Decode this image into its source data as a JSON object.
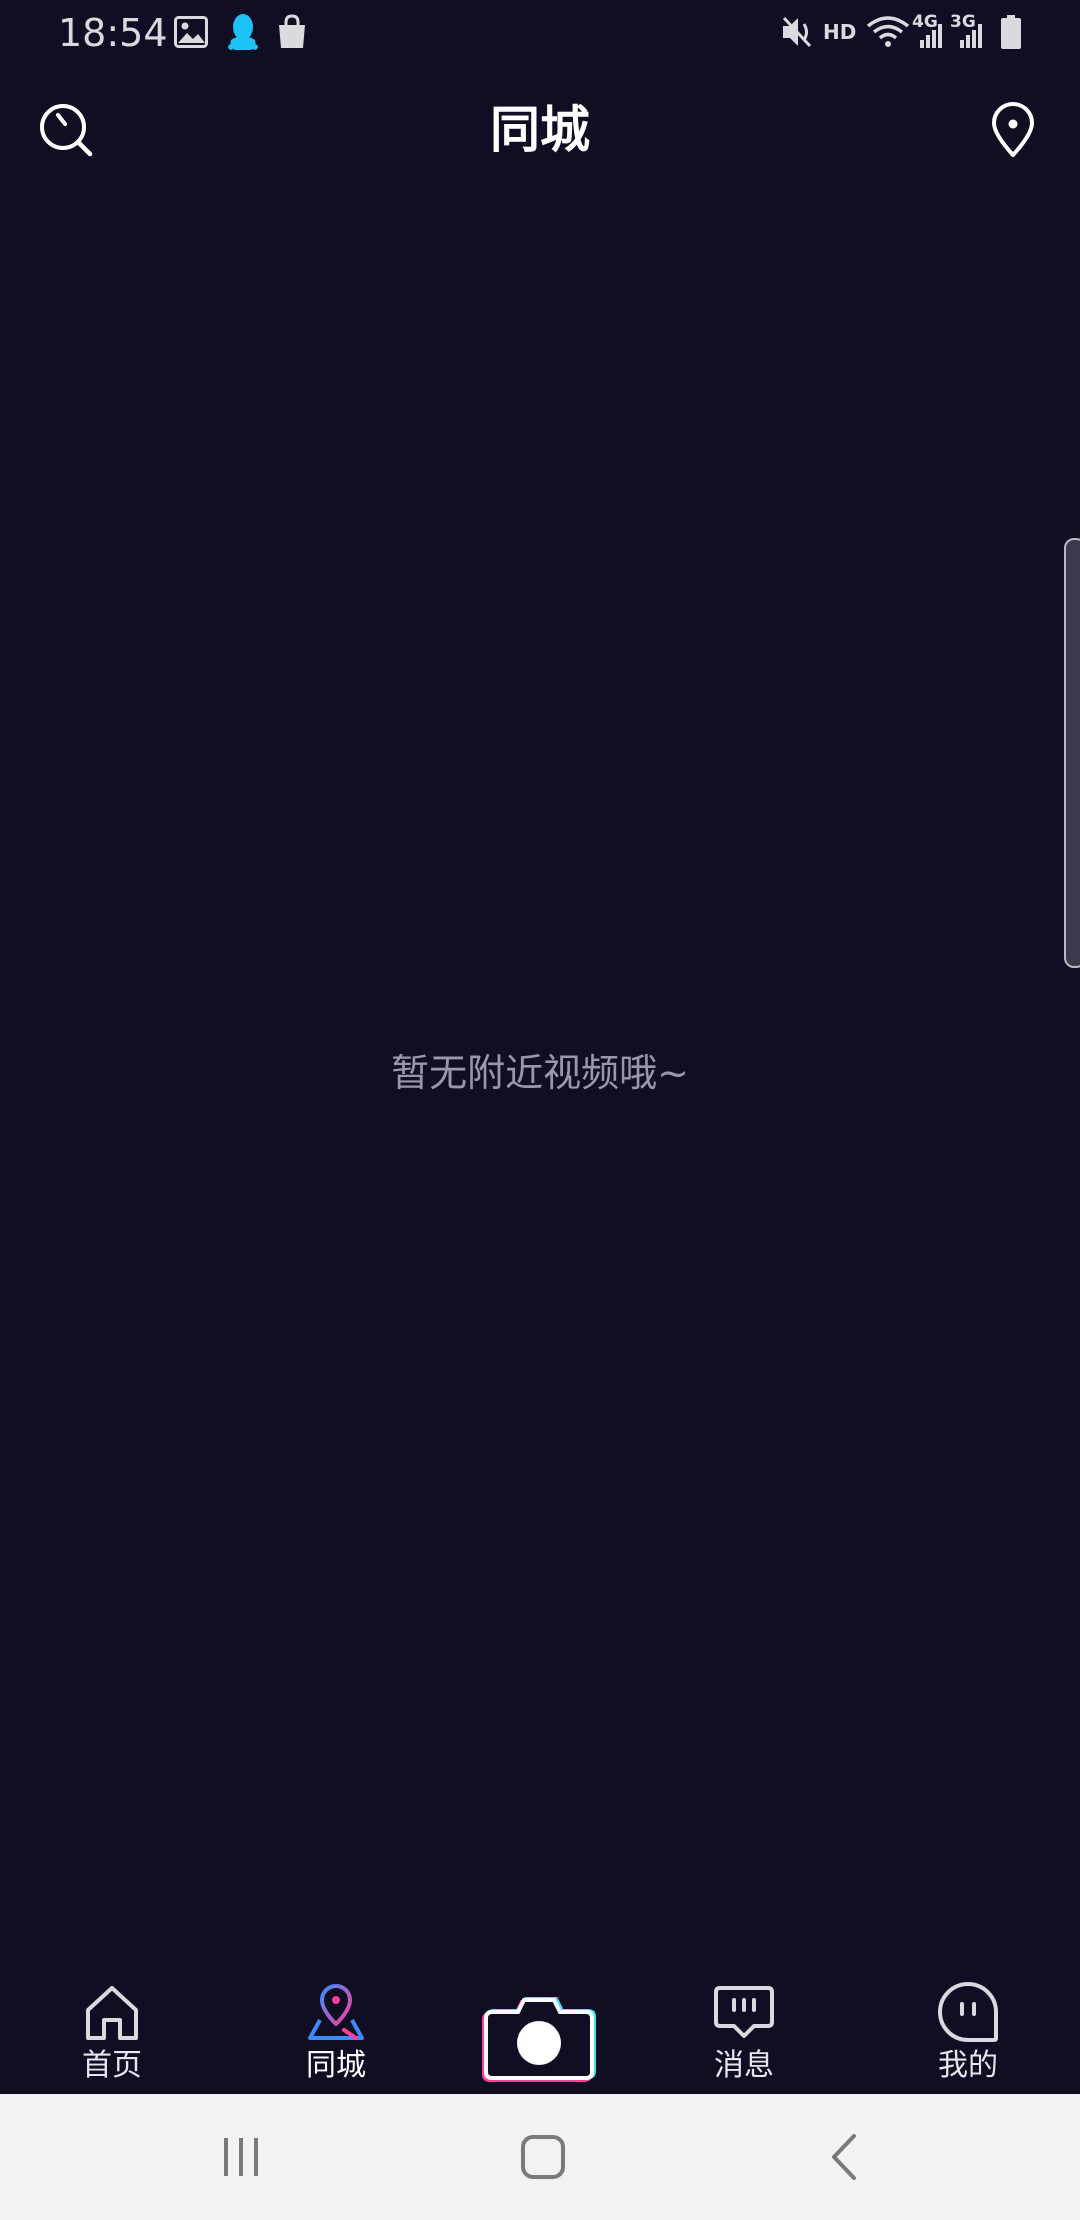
{
  "status_bar": {
    "time": "18:54",
    "network_hd": "HD",
    "net_4g": "4G",
    "net_3g": "3G",
    "icons": [
      "image-icon",
      "qq-penguin-icon",
      "shopping-bag-icon",
      "mute-icon",
      "wifi-icon",
      "signal-icon",
      "battery-icon"
    ],
    "qq_color": "#1ec3f5"
  },
  "header": {
    "title": "同城",
    "left_icon": "search-icon",
    "right_icon": "location-pin-icon"
  },
  "main": {
    "empty_message": "暂无附近视频哦~"
  },
  "tab_bar": {
    "tabs": [
      {
        "label": "首页",
        "icon": "home-icon"
      },
      {
        "label": "同城",
        "icon": "nearby-map-pin-icon",
        "active": true
      },
      {
        "label": "",
        "icon": "camera-icon"
      },
      {
        "label": "消息",
        "icon": "message-bubble-icon"
      },
      {
        "label": "我的",
        "icon": "profile-face-icon"
      }
    ],
    "accent_colors": {
      "blue": "#3a8bff",
      "pink": "#ff3d9a",
      "cyan": "#3ee6f5"
    }
  },
  "nav_bar": {
    "buttons": [
      "recent-apps-icon",
      "home-button-icon",
      "back-icon"
    ]
  }
}
